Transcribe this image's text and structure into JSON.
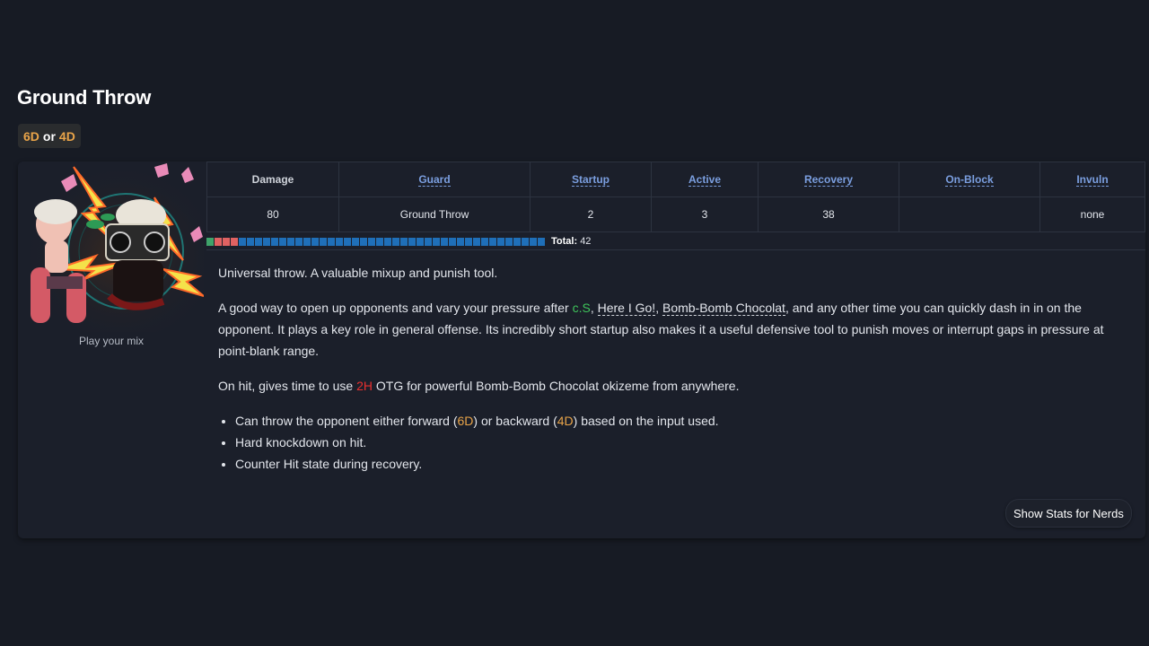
{
  "move": {
    "name": "Ground Throw",
    "inputs": [
      "6D",
      "or",
      "4D"
    ],
    "portrait_caption": "Play your mix"
  },
  "stats": {
    "headers": [
      "Damage",
      "Guard",
      "Startup",
      "Active",
      "Recovery",
      "On-Block",
      "Invuln"
    ],
    "values": [
      "80",
      "Ground Throw",
      "2",
      "3",
      "38",
      "",
      "none"
    ]
  },
  "framebar": {
    "startup_frames": 4,
    "active_frames": 0,
    "recovery_frames": 38,
    "total_label": "Total:",
    "total_value": "42",
    "colors": {
      "startup_first": "#3fa36a",
      "active": "#e06262",
      "recovery": "#1f6fb8"
    }
  },
  "description": {
    "p1": "Universal throw. A valuable mixup and punish tool.",
    "p2_pre": "A good way to open up opponents and vary your pressure after ",
    "p2_cs": "c.S",
    "p2_sep1": ", ",
    "p2_link1": "Here I Go!",
    "p2_sep2": ", ",
    "p2_link2": "Bomb-Bomb Chocolat",
    "p2_post": ", and any other time you can quickly dash in in on the opponent. It plays a key role in general offense. Its incredibly short startup also makes it a useful defensive tool to punish moves or interrupt gaps in pressure at point-blank range.",
    "p3_pre": "On hit, gives time to use ",
    "p3_2h": "2H",
    "p3_post": " OTG for powerful Bomb-Bomb Chocolat okizeme from anywhere.",
    "b1_pre": "Can throw the opponent either forward (",
    "b1_6d": "6D",
    "b1_mid": ") or backward (",
    "b1_4d": "4D",
    "b1_post": ") based on the input used.",
    "b2": "Hard knockdown on hit.",
    "b3": "Counter Hit state during recovery."
  },
  "buttons": {
    "nerds": "Show Stats for Nerds"
  }
}
